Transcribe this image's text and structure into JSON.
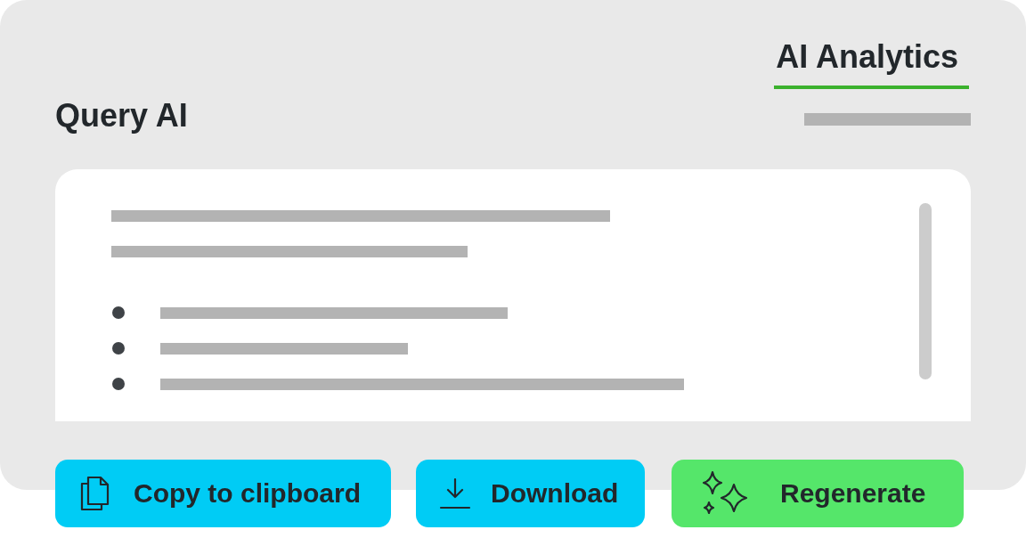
{
  "tab": {
    "label": "AI Analytics",
    "selected": true
  },
  "title": "Query AI",
  "actions": [
    {
      "kind": "copy",
      "label": "Copy to clipboard",
      "color": "#00ccf5"
    },
    {
      "kind": "download",
      "label": "Download",
      "color": "#00ccf5"
    },
    {
      "kind": "regenerate",
      "label": "Regenerate",
      "color": "#55e66a"
    }
  ]
}
